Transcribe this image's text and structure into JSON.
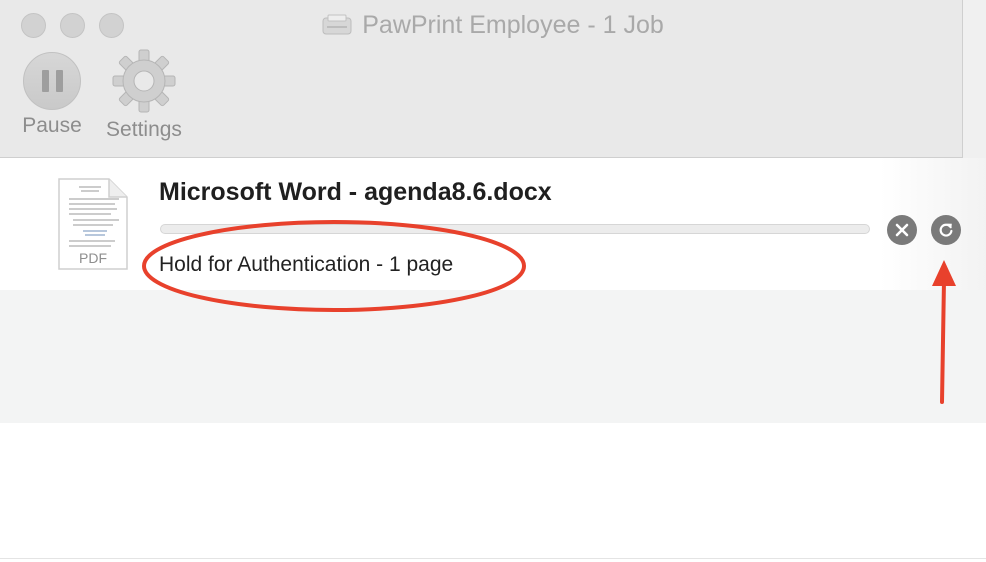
{
  "window": {
    "title": "PawPrint Employee - 1 Job"
  },
  "toolbar": {
    "pause_label": "Pause",
    "settings_label": "Settings"
  },
  "job": {
    "title": "Microsoft Word - agenda8.6.docx",
    "status": "Hold for Authentication - 1 page",
    "file_type_label": "PDF",
    "progress": 0,
    "cancel_icon": "close-icon",
    "retry_icon": "refresh-icon"
  },
  "annotation": {
    "color": "#e8412c",
    "ellipse_target": "job-status",
    "arrow_target": "retry-button"
  }
}
